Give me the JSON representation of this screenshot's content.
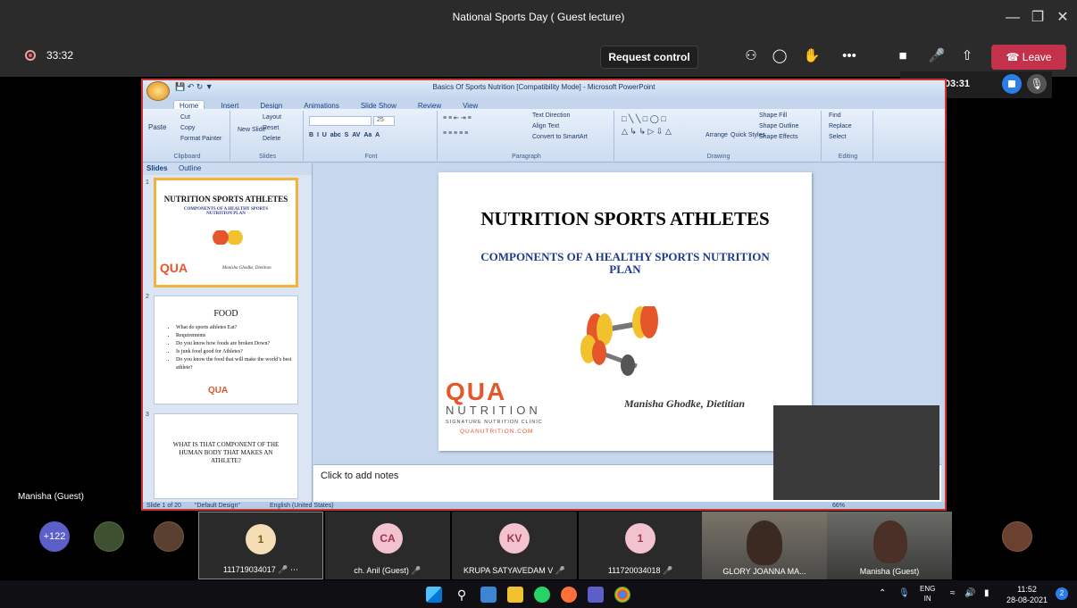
{
  "window": {
    "title": "National Sports Day ( Guest lecture)",
    "controls": [
      "minimize",
      "maximize",
      "close"
    ]
  },
  "toolbar": {
    "elapsed": "33:32",
    "request_control": "Request control",
    "leave": "Leave",
    "accent": "#c4314b"
  },
  "recording": {
    "time": "00:03:31"
  },
  "powerpoint": {
    "doc_title": "Basics Of Sports Nutrition [Compatibility Mode] - Microsoft PowerPoint",
    "tabs": [
      "Home",
      "Insert",
      "Design",
      "Animations",
      "Slide Show",
      "Review",
      "View"
    ],
    "ribbon": {
      "clipboard": {
        "cut": "Cut",
        "copy": "Copy",
        "paste": "Paste",
        "format_painter": "Format Painter",
        "label": "Clipboard"
      },
      "slides": {
        "layout": "Layout",
        "reset": "Reset",
        "new_slide": "New Slide",
        "delete": "Delete",
        "label": "Slides"
      },
      "font": {
        "size": "25",
        "label": "Font"
      },
      "paragraph": {
        "text_direction": "Text Direction",
        "align_text": "Align Text",
        "convert": "Convert to SmartArt",
        "label": "Paragraph"
      },
      "drawing": {
        "arrange": "Arrange",
        "quick_styles": "Quick Styles",
        "shape_fill": "Shape Fill",
        "shape_outline": "Shape Outline",
        "shape_effects": "Shape Effects",
        "label": "Drawing"
      },
      "editing": {
        "find": "Find",
        "replace": "Replace",
        "select": "Select",
        "label": "Editing"
      }
    },
    "panel_tabs": [
      "Slides",
      "Outline"
    ],
    "thumbnails": [
      {
        "num": "1",
        "title": "NUTRITION SPORTS ATHLETES",
        "sub": "COMPONENTS OF A HEALTHY SPORTS NUTRITION PLAN",
        "author": "Manisha Ghodke, Dietitian"
      },
      {
        "num": "2",
        "title": "FOOD",
        "bullets": [
          "What do sports athletes Eat?",
          "Requirements",
          "Do you know how foods are broken Down?",
          "Is junk food good for Athletes?",
          "Do you know the food that will make the world’s best athlete?"
        ]
      },
      {
        "num": "3",
        "body": "WHAT IS THAT COMPONENT OF THE HUMAN BODY THAT MAKES AN ATHLETE?"
      }
    ],
    "slide": {
      "title": "NUTRITION SPORTS ATHLETES",
      "subtitle": "COMPONENTS OF A HEALTHY SPORTS NUTRITION PLAN",
      "author": "Manisha Ghodke, Dietitian",
      "logo": {
        "mark": "QUA",
        "nutrition": "NUTRITION",
        "signature": "SIGNATURE NUTRITION CLINIC",
        "url": "QUANUTRITION.COM"
      }
    },
    "notes_placeholder": "Click to add notes",
    "status": {
      "slide": "Slide 1 of 20",
      "design": "\"Default Design\"",
      "language": "English (United States)",
      "zoom": "66%"
    }
  },
  "presenter_label": "Manisha (Guest)",
  "participants": {
    "overflow": "+122",
    "tiles": [
      {
        "initials": "1",
        "name": "111719034017",
        "color": "#f5deb3",
        "text_color": "#7a5a1a"
      },
      {
        "initials": "CA",
        "name": "ch. Anil (Guest)",
        "color": "#f3c2cf",
        "text_color": "#a3324d"
      },
      {
        "initials": "KV",
        "name": "KRUPA SATYAVEDAM V",
        "color": "#f3c2cf",
        "text_color": "#a3324d"
      },
      {
        "initials": "1",
        "name": "111720034018",
        "color": "#f3c2cf",
        "text_color": "#a3324d"
      }
    ],
    "video_tiles": [
      {
        "name": "GLORY JOANNA MA..."
      },
      {
        "name": "Manisha (Guest)"
      }
    ]
  },
  "taskbar": {
    "lang": "ENG",
    "region": "IN",
    "time": "11:52",
    "date": "28-08-2021",
    "notifications": "2"
  }
}
